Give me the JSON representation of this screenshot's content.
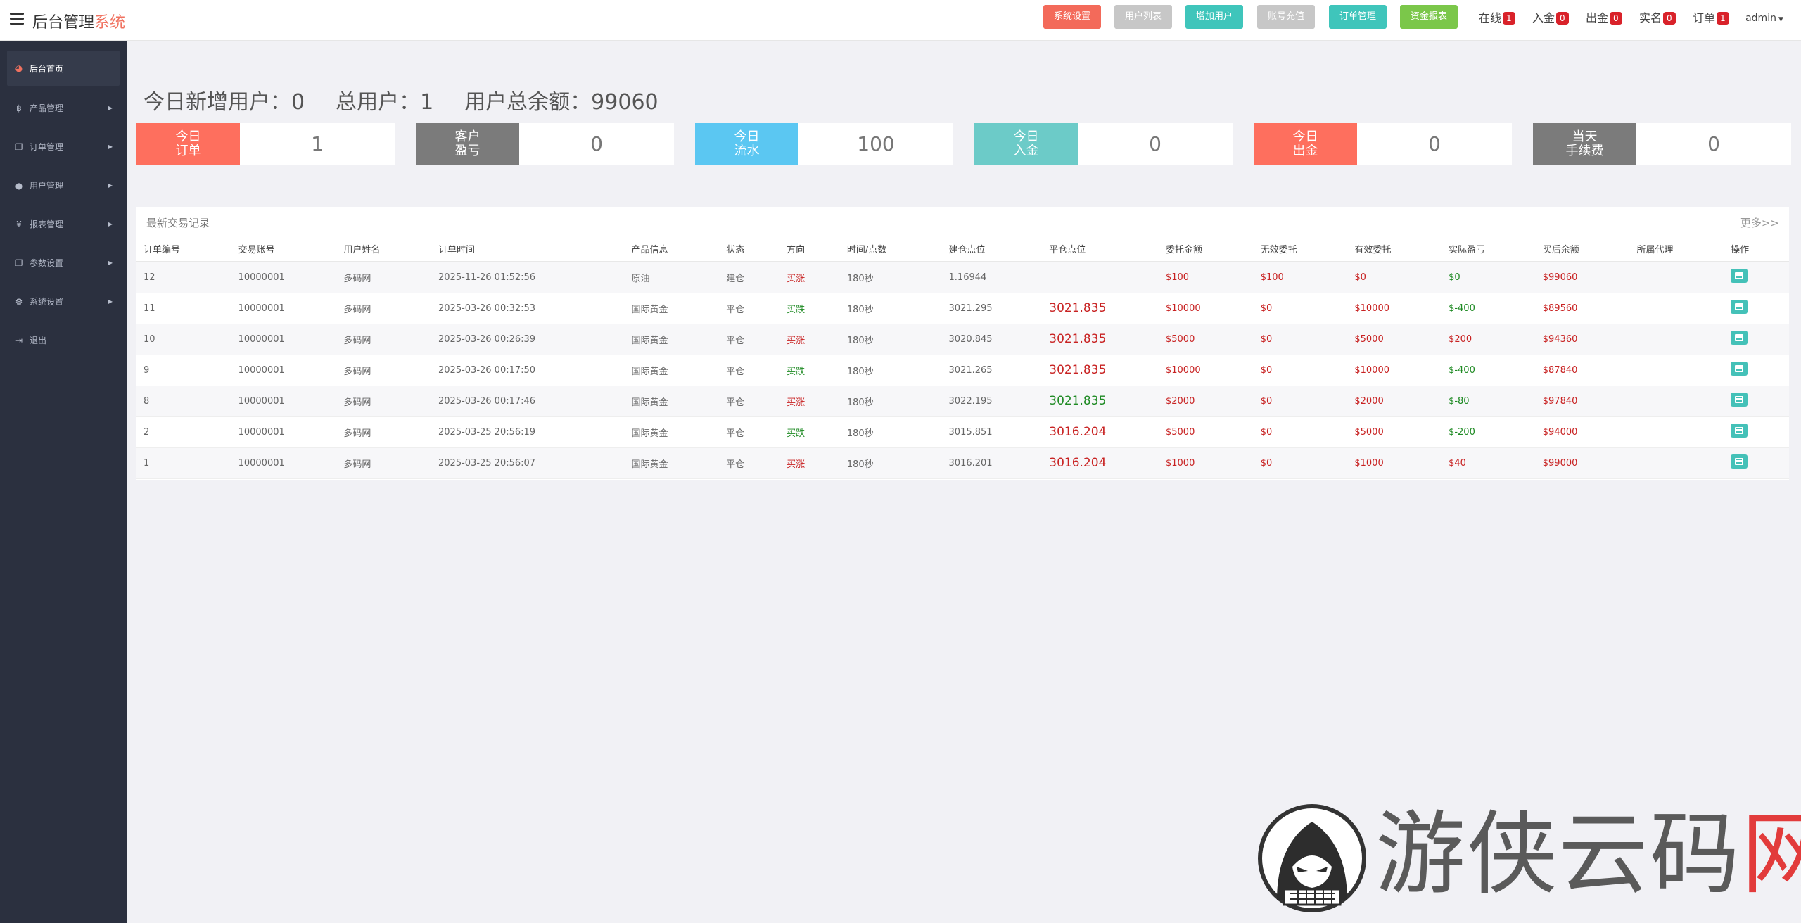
{
  "header": {
    "brand_main": "后台管理",
    "brand_accent": "系统",
    "buttons": [
      {
        "label": "系统设置",
        "color": "#f36a5a"
      },
      {
        "label": "用户列表",
        "color": "#c7c7c7"
      },
      {
        "label": "增加用户",
        "color": "#3fc5bb"
      },
      {
        "label": "账号充值",
        "color": "#c7c7c7"
      },
      {
        "label": "订单管理",
        "color": "#3fc5bb"
      },
      {
        "label": "资金报表",
        "color": "#7bc74a"
      }
    ],
    "stats": [
      {
        "label": "在线",
        "count": "1"
      },
      {
        "label": "入金",
        "count": "0"
      },
      {
        "label": "出金",
        "count": "0"
      },
      {
        "label": "实名",
        "count": "0"
      },
      {
        "label": "订单",
        "count": "1"
      }
    ],
    "user": "admin"
  },
  "sidebar": {
    "items": [
      {
        "label": "后台首页",
        "icon": "dashboard-icon",
        "active": true
      },
      {
        "label": "产品管理",
        "icon": "bitcoin-icon"
      },
      {
        "label": "订单管理",
        "icon": "copy-icon"
      },
      {
        "label": "用户管理",
        "icon": "user-icon"
      },
      {
        "label": "报表管理",
        "icon": "yen-icon"
      },
      {
        "label": "参数设置",
        "icon": "copy-icon"
      },
      {
        "label": "系统设置",
        "icon": "gears-icon"
      },
      {
        "label": "退出",
        "icon": "sign-out-icon"
      }
    ]
  },
  "summary": {
    "new_users": "今日新增用户：0",
    "total_users": "总用户：1",
    "total_balance": "用户总余额：99060"
  },
  "cards": [
    {
      "line1": "今日",
      "line2": "订单",
      "value": "1",
      "color": "#fe6f5e"
    },
    {
      "line1": "客户",
      "line2": "盈亏",
      "value": "0",
      "color": "#7b7b7b"
    },
    {
      "line1": "今日",
      "line2": "流水",
      "value": "100",
      "color": "#5bc7f2"
    },
    {
      "line1": "今日",
      "line2": "入金",
      "value": "0",
      "color": "#6ccbc8"
    },
    {
      "line1": "今日",
      "line2": "出金",
      "value": "0",
      "color": "#fe6f5e"
    },
    {
      "line1": "当天",
      "line2": "手续费",
      "value": "0",
      "color": "#7b7b7b"
    }
  ],
  "transactions": {
    "title": "最新交易记录",
    "more": "更多>>",
    "columns": [
      "订单编号",
      "交易账号",
      "用户姓名",
      "订单时间",
      "产品信息",
      "状态",
      "方向",
      "时间/点数",
      "建仓点位",
      "平仓点位",
      "委托金额",
      "无效委托",
      "有效委托",
      "实际盈亏",
      "买后余额",
      "所属代理",
      "操作"
    ],
    "rows": [
      {
        "id": "12",
        "account": "10000001",
        "name": "多码网",
        "time": "2025-11-26 01:52:56",
        "product": "原油",
        "status": "建仓",
        "dir": "买涨",
        "dir_color": "red",
        "duration": "180秒",
        "open": "1.16944",
        "close": "",
        "close_color": "red",
        "amount": "$100",
        "invalid": "$100",
        "valid": "$0",
        "pnl": "$0",
        "pnl_color": "green",
        "balance": "$99060"
      },
      {
        "id": "11",
        "account": "10000001",
        "name": "多码网",
        "time": "2025-03-26 00:32:53",
        "product": "国际黄金",
        "status": "平仓",
        "dir": "买跌",
        "dir_color": "green",
        "duration": "180秒",
        "open": "3021.295",
        "close": "3021.835",
        "close_color": "red",
        "amount": "$10000",
        "invalid": "$0",
        "valid": "$10000",
        "pnl": "$-400",
        "pnl_color": "green",
        "balance": "$89560"
      },
      {
        "id": "10",
        "account": "10000001",
        "name": "多码网",
        "time": "2025-03-26 00:26:39",
        "product": "国际黄金",
        "status": "平仓",
        "dir": "买涨",
        "dir_color": "red",
        "duration": "180秒",
        "open": "3020.845",
        "close": "3021.835",
        "close_color": "red",
        "amount": "$5000",
        "invalid": "$0",
        "valid": "$5000",
        "pnl": "$200",
        "pnl_color": "red",
        "balance": "$94360"
      },
      {
        "id": "9",
        "account": "10000001",
        "name": "多码网",
        "time": "2025-03-26 00:17:50",
        "product": "国际黄金",
        "status": "平仓",
        "dir": "买跌",
        "dir_color": "green",
        "duration": "180秒",
        "open": "3021.265",
        "close": "3021.835",
        "close_color": "red",
        "amount": "$10000",
        "invalid": "$0",
        "valid": "$10000",
        "pnl": "$-400",
        "pnl_color": "green",
        "balance": "$87840"
      },
      {
        "id": "8",
        "account": "10000001",
        "name": "多码网",
        "time": "2025-03-26 00:17:46",
        "product": "国际黄金",
        "status": "平仓",
        "dir": "买涨",
        "dir_color": "red",
        "duration": "180秒",
        "open": "3022.195",
        "close": "3021.835",
        "close_color": "green",
        "amount": "$2000",
        "invalid": "$0",
        "valid": "$2000",
        "pnl": "$-80",
        "pnl_color": "green",
        "balance": "$97840"
      },
      {
        "id": "2",
        "account": "10000001",
        "name": "多码网",
        "time": "2025-03-25 20:56:19",
        "product": "国际黄金",
        "status": "平仓",
        "dir": "买跌",
        "dir_color": "green",
        "duration": "180秒",
        "open": "3015.851",
        "close": "3016.204",
        "close_color": "red",
        "amount": "$5000",
        "invalid": "$0",
        "valid": "$5000",
        "pnl": "$-200",
        "pnl_color": "green",
        "balance": "$94000"
      },
      {
        "id": "1",
        "account": "10000001",
        "name": "多码网",
        "time": "2025-03-25 20:56:07",
        "product": "国际黄金",
        "status": "平仓",
        "dir": "买涨",
        "dir_color": "red",
        "duration": "180秒",
        "open": "3016.201",
        "close": "3016.204",
        "close_color": "red",
        "amount": "$1000",
        "invalid": "$0",
        "valid": "$1000",
        "pnl": "$40",
        "pnl_color": "red",
        "balance": "$99000"
      }
    ]
  },
  "watermark": {
    "text": "游侠云码",
    "mark": "网"
  }
}
